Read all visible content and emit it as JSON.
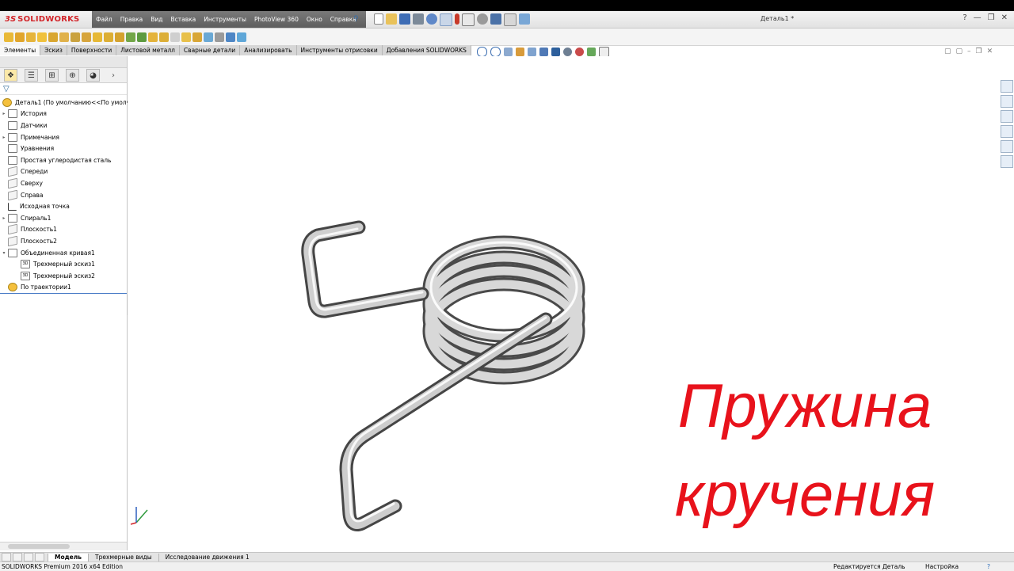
{
  "app": {
    "logo_prefix": "3S",
    "logo_text": "SOLIDWORKS",
    "document_title": "Деталь1 *"
  },
  "menu": {
    "items": [
      "Файл",
      "Правка",
      "Вид",
      "Вставка",
      "Инструменты",
      "PhotoView 360",
      "Окно",
      "Справка"
    ]
  },
  "command_tabs": [
    "Элементы",
    "Эскиз",
    "Поверхности",
    "Листовой металл",
    "Сварные детали",
    "Анализировать",
    "Инструменты отрисовки",
    "Добавления SOLIDWORKS"
  ],
  "feature_tree": {
    "root": "Деталь1  (По умолчанию<<По умолча",
    "items": [
      {
        "label": "История",
        "expandable": true
      },
      {
        "label": "Датчики",
        "expandable": false
      },
      {
        "label": "Примечания",
        "expandable": true
      },
      {
        "label": "Уравнения",
        "expandable": false
      },
      {
        "label": "Простая углеродистая сталь",
        "expandable": false
      },
      {
        "label": "Спереди",
        "expandable": false
      },
      {
        "label": "Сверху",
        "expandable": false
      },
      {
        "label": "Справа",
        "expandable": false
      },
      {
        "label": "Исходная точка",
        "expandable": false
      },
      {
        "label": "Спираль1",
        "expandable": true
      },
      {
        "label": "Плоскость1",
        "expandable": false
      },
      {
        "label": "Плоскость2",
        "expandable": false
      },
      {
        "label": "Объединенная кривая1",
        "expandable": true
      },
      {
        "label": "Трехмерный эскиз1",
        "expandable": false
      },
      {
        "label": "Трехмерный эскиз2",
        "expandable": false
      },
      {
        "label": "По траектории1",
        "expandable": false
      }
    ],
    "sketch_icon_label": "3D"
  },
  "overlay": {
    "line1": "Пружина",
    "line2": "кручения",
    "color": "#e8121b"
  },
  "bottom_tabs": [
    "Модель",
    "Трехмерные виды",
    "Исследование движения 1"
  ],
  "status": {
    "edition": "SOLIDWORKS Premium 2016 x64 Edition",
    "mode": "Редактируется Деталь",
    "custom": "Настройка",
    "help_icon": "?"
  },
  "window_controls": {
    "help": "?",
    "minimize": "—",
    "restore": "❐",
    "close": "✕"
  },
  "icons": [
    "new-icon",
    "open-icon",
    "save-icon",
    "print-icon",
    "undo-icon",
    "select-icon",
    "rebuild-icon",
    "options-icon",
    "zoom-icon",
    "view-orientation-icon",
    "display-style-icon",
    "appearance-icon"
  ]
}
